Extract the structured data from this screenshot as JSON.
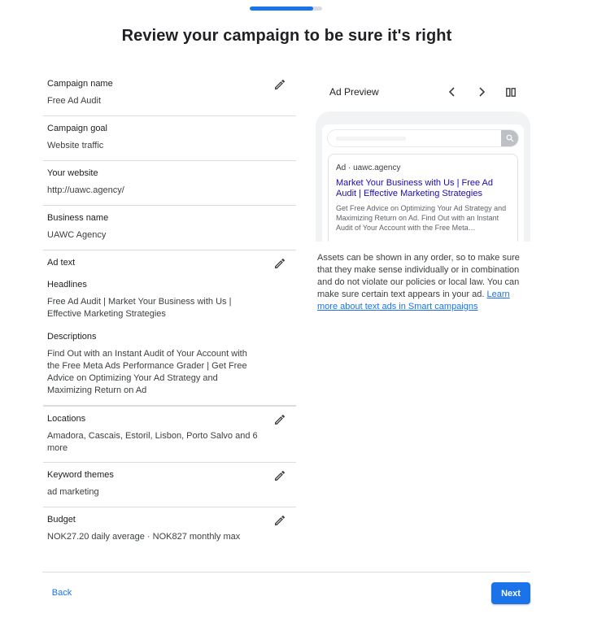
{
  "progress": {
    "fraction": 0.88
  },
  "page_title": "Review your campaign to be sure it's right",
  "sections": {
    "campaign_name": {
      "label": "Campaign name",
      "value": "Free Ad Audit"
    },
    "campaign_goal": {
      "label": "Campaign goal",
      "value": "Website traffic"
    },
    "website": {
      "label": "Your website",
      "value": "http://uawc.agency/"
    },
    "business_name": {
      "label": "Business name",
      "value": "UAWC Agency"
    },
    "ad_text": {
      "label": "Ad text",
      "headlines_label": "Headlines",
      "headlines": "Free Ad Audit | Market Your Business with Us | Effective Marketing Strategies",
      "descriptions_label": "Descriptions",
      "descriptions": "Find Out with an Instant Audit of Your Account with the Free Meta Ads Performance Grader | Get Free Advice on Optimizing Your Ad Strategy and Maximizing Return on Ad"
    },
    "locations": {
      "label": "Locations",
      "value": "Amadora, Cascais, Estoril, Lisbon, Porto Salvo and 6 more"
    },
    "keyword_themes": {
      "label": "Keyword themes",
      "value": "ad marketing"
    },
    "budget": {
      "label": "Budget",
      "value": "NOK27.20 daily average · NOK827 monthly max"
    }
  },
  "preview": {
    "title": "Ad Preview",
    "ad_meta": "Ad · uawc.agency",
    "ad_headline": "Market Your Business with Us | Free Ad Audit | Effective Marketing Strategies",
    "ad_description": "Get Free Advice on Optimizing Your Ad Strategy and Maximizing Return on Ad. Find Out with an Instant Audit of Your Account with the Free Meta…",
    "note": "Assets can be shown in any order, so to make sure that they make sense individually or in combination and do not violate our policies or local law. You can make sure certain text appears in your ad. ",
    "learn_more_link": "Learn more about text ads in Smart campaigns"
  },
  "footer": {
    "back_label": "Back",
    "next_label": "Next"
  },
  "colors": {
    "accent": "#1a73e8",
    "ad_headline": "#1a0dab",
    "divider": "#dadce0"
  }
}
